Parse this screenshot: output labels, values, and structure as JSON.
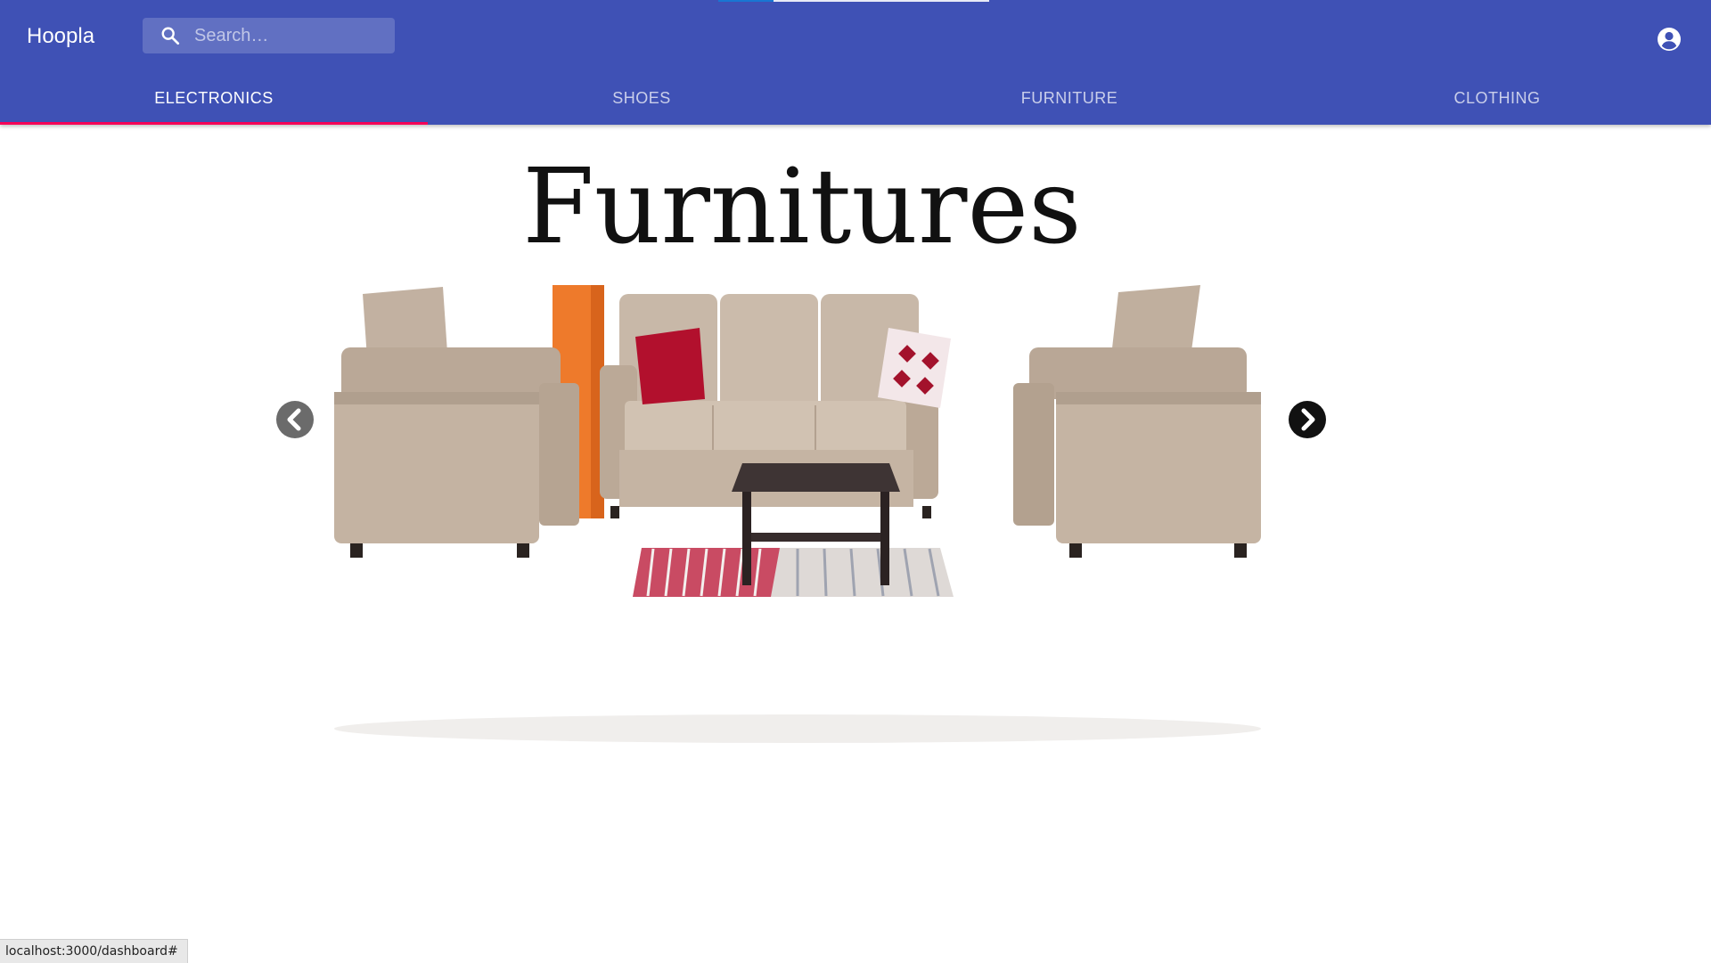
{
  "app": {
    "brand": "Hoopla"
  },
  "search": {
    "placeholder": "Search…",
    "icon": "search-icon"
  },
  "account": {
    "icon": "account-circle-icon"
  },
  "tabs": [
    {
      "label": "ELECTRONICS",
      "active": true
    },
    {
      "label": "SHOES",
      "active": false
    },
    {
      "label": "FURNITURE",
      "active": false
    },
    {
      "label": "CLOTHING",
      "active": false
    }
  ],
  "carousel": {
    "slide_title": "Furnitures",
    "prev_icon": "chevron-left-icon",
    "next_icon": "chevron-right-icon"
  },
  "status": {
    "url": "localhost:3000/dashboard#"
  },
  "colors": {
    "appbar": "#3f51b5",
    "tab_indicator": "#f50057",
    "background": "#ffffff"
  }
}
